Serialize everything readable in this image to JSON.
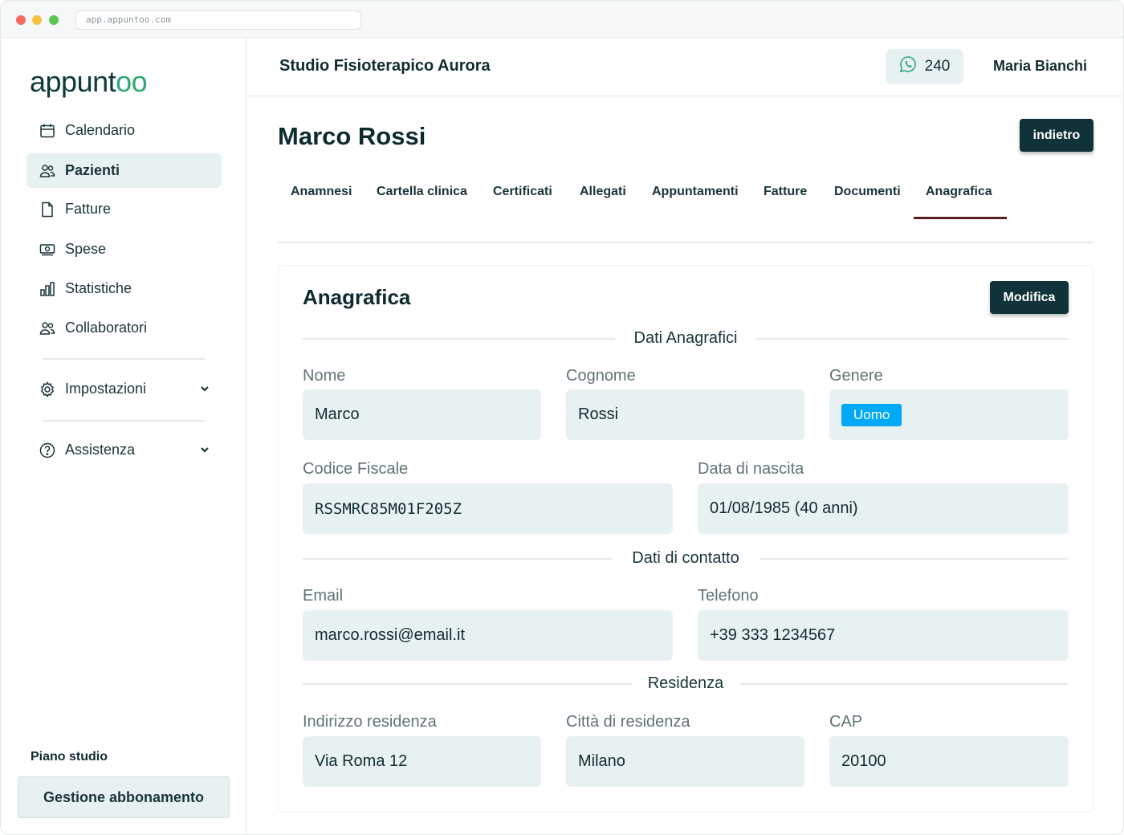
{
  "browser": {
    "url": "app.appuntoo.com"
  },
  "sidebar": {
    "logo": {
      "text_main": "appunt",
      "text_accent": "oo"
    },
    "items": [
      {
        "label": "Calendario",
        "icon": "calendar-icon"
      },
      {
        "label": "Pazienti",
        "icon": "users-icon",
        "active": true
      },
      {
        "label": "Fatture",
        "icon": "document-icon"
      },
      {
        "label": "Spese",
        "icon": "cash-icon"
      },
      {
        "label": "Statistiche",
        "icon": "bar-chart-icon"
      },
      {
        "label": "Collaboratori",
        "icon": "users-icon"
      }
    ],
    "settings": {
      "label": "Impostazioni",
      "icon": "gear-icon"
    },
    "help": {
      "label": "Assistenza",
      "icon": "question-circle-icon"
    },
    "plan_label": "Piano studio",
    "plan_button": "Gestione abbonamento"
  },
  "header": {
    "studio_name": "Studio Fisioterapico Aurora",
    "whatsapp_credits": "240",
    "user_name": "Maria Bianchi"
  },
  "patient": {
    "name": "Marco Rossi",
    "back_button": "indietro",
    "tabs": [
      {
        "label": "Anamnesi"
      },
      {
        "label": "Cartella clinica"
      },
      {
        "label": "Certificati"
      },
      {
        "label": "Allegati"
      },
      {
        "label": "Appuntamenti"
      },
      {
        "label": "Fatture"
      },
      {
        "label": "Documenti"
      },
      {
        "label": "Anagrafica",
        "active": true
      }
    ]
  },
  "anagrafica": {
    "title": "Anagrafica",
    "edit_button": "Modifica",
    "sections": {
      "personal": "Dati Anagrafici",
      "contact": "Dati di contatto",
      "residence": "Residenza"
    },
    "fields": {
      "nome": {
        "label": "Nome",
        "value": "Marco"
      },
      "cognome": {
        "label": "Cognome",
        "value": "Rossi"
      },
      "genere": {
        "label": "Genere",
        "value": "Uomo"
      },
      "codice_fiscale": {
        "label": "Codice Fiscale",
        "value": "RSSMRC85M01F205Z"
      },
      "data_nascita": {
        "label": "Data di nascita",
        "value": "01/08/1985 (40 anni)"
      },
      "email": {
        "label": "Email",
        "value": "marco.rossi@email.it"
      },
      "telefono": {
        "label": "Telefono",
        "value": "+39 333 1234567"
      },
      "indirizzo": {
        "label": "Indirizzo residenza",
        "value": "Via Roma 12"
      },
      "citta": {
        "label": "Città di residenza",
        "value": "Milano"
      },
      "cap": {
        "label": "CAP",
        "value": "20100"
      }
    }
  },
  "colors": {
    "primary_dark": "#0f3338",
    "field_bg": "#e8f1f2",
    "active_tab_underline": "#5a1d1d",
    "gender_badge": "#00aaf6",
    "logo_accent": "#2ea872",
    "whatsapp_green": "#2ea872"
  }
}
